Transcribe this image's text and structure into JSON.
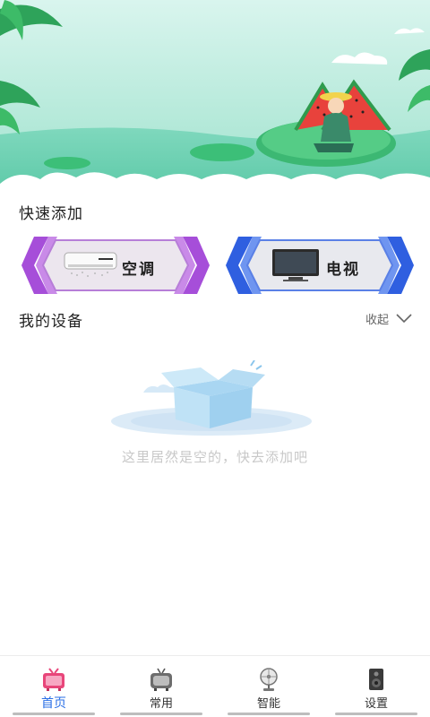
{
  "quick_add": {
    "title": "快速添加",
    "cards": [
      {
        "label": "空调",
        "icon": "air-conditioner-icon",
        "accent": "#a64ed9"
      },
      {
        "label": "电视",
        "icon": "television-icon",
        "accent": "#2f5fe0"
      }
    ]
  },
  "devices": {
    "title": "我的设备",
    "collapse_label": "收起",
    "empty_text": "这里居然是空的，快去添加吧"
  },
  "bottom_nav": [
    {
      "label": "首页",
      "icon": "retro-tv-icon",
      "active": true
    },
    {
      "label": "常用",
      "icon": "old-tv-icon",
      "active": false
    },
    {
      "label": "智能",
      "icon": "fan-icon",
      "active": false
    },
    {
      "label": "设置",
      "icon": "speaker-icon",
      "active": false
    }
  ],
  "colors": {
    "active_tab": "#2a6fe6",
    "empty_text": "#c8c8c8"
  }
}
